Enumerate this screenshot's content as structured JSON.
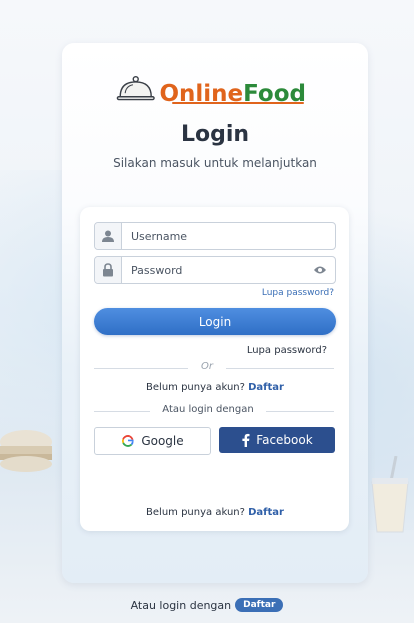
{
  "brand": {
    "name_part1": "Online",
    "name_part2": "Food"
  },
  "header": {
    "title": "Login",
    "subtitle": "Silakan masuk untuk melanjutkan"
  },
  "form": {
    "username_placeholder": "Username",
    "password_placeholder": "Password",
    "forgot_small": "Lupa password?",
    "login_label": "Login",
    "forgot_large": "Lupa password?",
    "or_label": "Or"
  },
  "register": {
    "prompt": "Belum punya akun? ",
    "link": "Daftar"
  },
  "social": {
    "alt_label": "Atau login dengan",
    "google_label": "Google",
    "facebook_label": "Facebook"
  },
  "register_bottom": {
    "prompt": "Belum punya akun? ",
    "link": "Daftar"
  },
  "footer": {
    "text": "Atau login dengan",
    "pill": "Daftar"
  },
  "colors": {
    "primary": "#2f6fc6",
    "facebook": "#2c4f8e",
    "brand_orange": "#e0641c",
    "brand_green": "#2c8a3a"
  }
}
